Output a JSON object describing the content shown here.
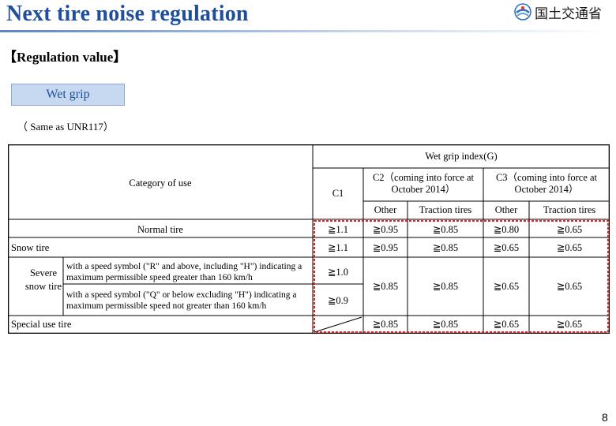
{
  "slide": {
    "title": "Next tire noise regulation",
    "logo_text": "国土交通省",
    "section": "【Regulation value】",
    "pill_label": "Wet grip",
    "note": "（ Same as UNR117）",
    "page_number": "8"
  },
  "table": {
    "header_index": "Wet grip index(G)",
    "category_header": "Category of use",
    "col_c1": "C1",
    "col_c2": "C2（coming into force at October 2014）",
    "col_c3": "C3（coming into force at October 2014）",
    "sub_other": "Other",
    "sub_traction": "Traction tires",
    "rows": {
      "normal": {
        "label": "Normal tire",
        "c1": "≧1.1",
        "c2_other": "≧0.95",
        "c2_traction": "≧0.85",
        "c3_other": "≧0.80",
        "c3_traction": "≧0.65"
      },
      "snow": {
        "label": "Snow tire",
        "c1": "≧1.1",
        "c2_other": "≧0.95",
        "c2_traction": "≧0.85",
        "c3_other": "≧0.65",
        "c3_traction": "≧0.65"
      },
      "severe": {
        "label": "Severe snow tire",
        "sub1": "with a speed symbol (\"R\" and above, including \"H\") indicating a maximum permissible speed greater than 160 km/h",
        "sub1_c1": "≧1.0",
        "sub2": "with a speed symbol (\"Q\" or below excluding \"H\") indicating a maximum permissible speed not greater than 160 km/h",
        "sub2_c1": "≧0.9",
        "c2_other": "≧0.85",
        "c2_traction": "≧0.85",
        "c3_other": "≧0.65",
        "c3_traction": "≧0.65"
      },
      "special": {
        "label": "Special use tire",
        "c2_other": "≧0.85",
        "c2_traction": "≧0.85",
        "c3_other": "≧0.65",
        "c3_traction": "≧0.65"
      }
    }
  },
  "colors": {
    "title": "#1f4e9c",
    "pill_bg": "#c6d9f0",
    "highlight_border": "#e02020"
  }
}
